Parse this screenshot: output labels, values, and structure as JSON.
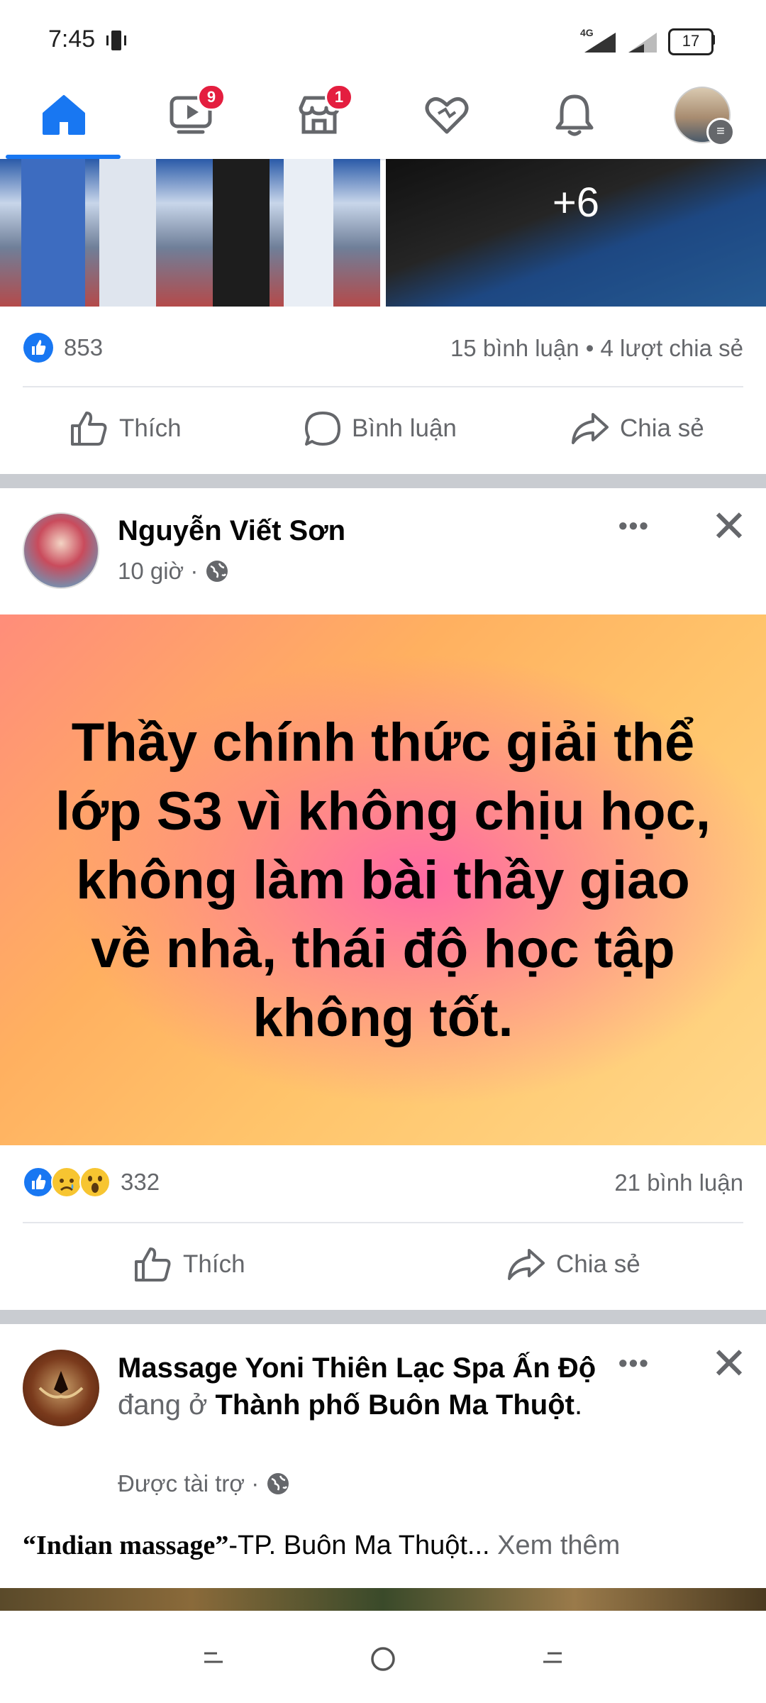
{
  "status_bar": {
    "time": "7:45",
    "network": "4G",
    "battery": "17"
  },
  "nav": {
    "tabs": [
      {
        "name": "home",
        "active": true
      },
      {
        "name": "watch",
        "badge": "9"
      },
      {
        "name": "marketplace",
        "badge": "1"
      },
      {
        "name": "dating"
      },
      {
        "name": "notifications"
      },
      {
        "name": "profile-menu"
      }
    ],
    "accent": "#1877f2"
  },
  "post1": {
    "more_photos": "+6",
    "like_count": "853",
    "comments_shares": "15 bình luận • 4 lượt chia sẻ",
    "actions": {
      "like": "Thích",
      "comment": "Bình luận",
      "share": "Chia sẻ"
    }
  },
  "post2": {
    "author": "Nguyễn Viết Sơn",
    "time": "10 giờ ·",
    "text": "Thầy chính thức giải thể lớp S3 vì không chịu học, không làm bài thầy giao về nhà, thái độ học tập không tốt.",
    "reaction_count": "332",
    "comments": "21 bình luận",
    "actions": {
      "like": "Thích",
      "share": "Chia sẻ"
    }
  },
  "post3": {
    "author": "Massage Yoni Thiên Lạc Spa Ấn Độ",
    "location_prefix": "đang ở",
    "location": "Thành phố Buôn Ma Thuột",
    "period": ".",
    "sponsored": "Được tài trợ ·",
    "text_bold": "“Indian massage”",
    "text": "-TP. Buôn Ma Thuột...",
    "see_more": "Xem thêm"
  }
}
